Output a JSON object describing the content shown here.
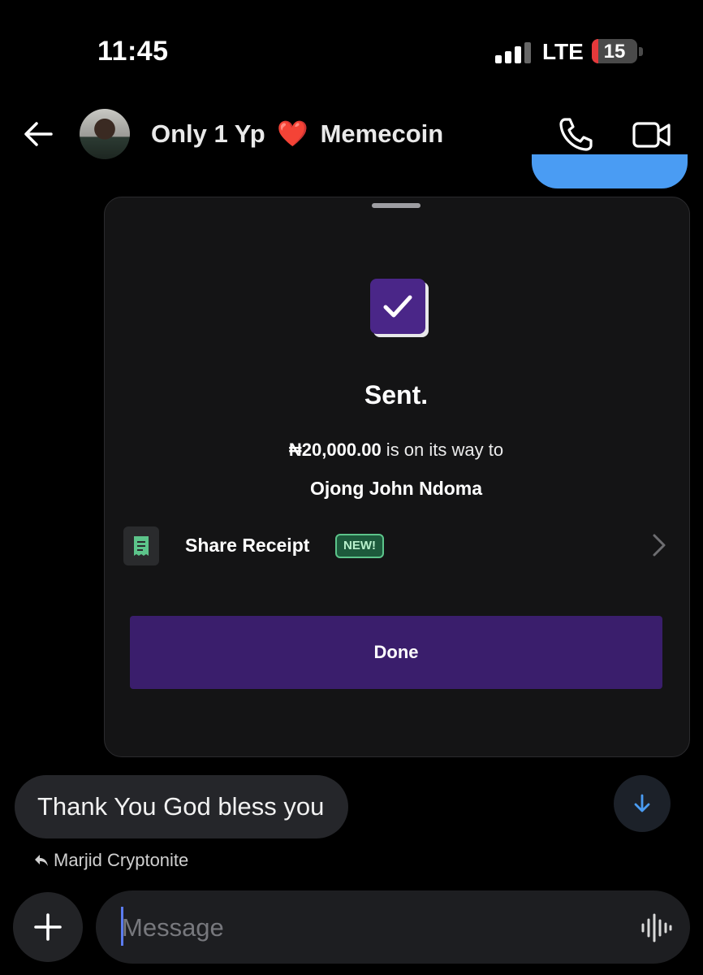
{
  "status_bar": {
    "time": "11:45",
    "network": "LTE",
    "battery": "15",
    "battery_color": "#e5393b"
  },
  "header": {
    "title": "Only 1 Yp",
    "heart": "❤️",
    "title_suffix": "Memecoin"
  },
  "payment_card": {
    "title": "Sent.",
    "amount": "₦20,000.00",
    "amount_suffix": " is on its way to",
    "recipient": "Ojong John Ndoma",
    "share_receipt_label": "Share Receipt",
    "new_badge": "NEW!",
    "done_label": "Done",
    "accent_color": "#3a1e6c"
  },
  "message": {
    "text": "Thank You God bless you",
    "sender": "Marjid Cryptonite"
  },
  "composer": {
    "placeholder": "Message"
  },
  "icons": [
    "back-arrow-icon",
    "phone-icon",
    "video-camera-icon",
    "checkmark-icon",
    "receipt-icon",
    "chevron-right-icon",
    "arrow-down-icon",
    "reply-icon",
    "plus-icon",
    "voice-waveform-icon"
  ]
}
